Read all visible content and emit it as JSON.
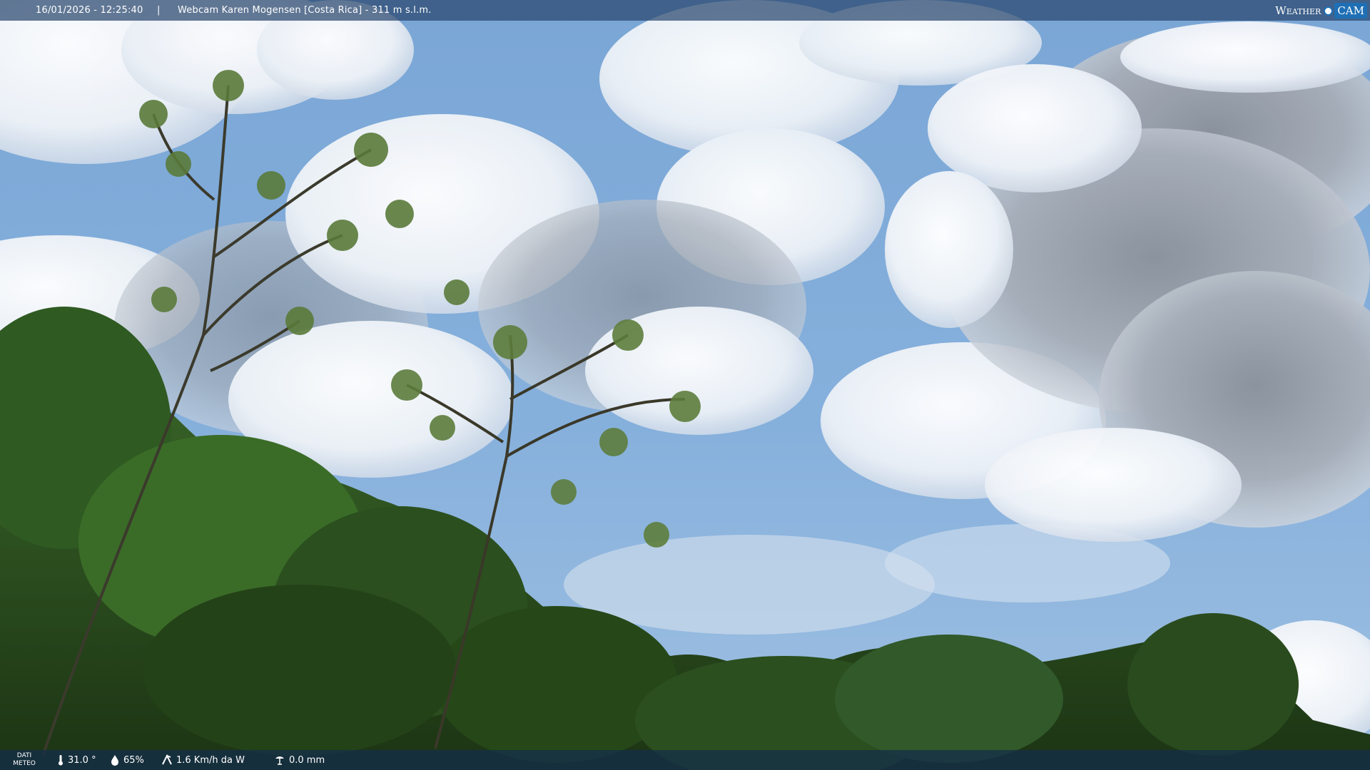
{
  "header": {
    "datetime": "16/01/2026 - 12:25:40",
    "separator": "|",
    "caption": "Webcam Karen Mogensen [Costa Rica] - 311 m s.l.m."
  },
  "logo": {
    "left_text": "Weather",
    "right_text": "CAM"
  },
  "footer": {
    "label_line1": "DATI",
    "label_line2": "METEO",
    "temperature": "31.0 °",
    "humidity": "65%",
    "wind": "1.6 Km/h da W",
    "rain": "0.0 mm",
    "icons": [
      "thermometer-icon",
      "humidity-drop-icon",
      "wind-icon",
      "rain-gauge-icon"
    ]
  },
  "colors": {
    "sky": "#6f9ccc",
    "bar": "#284670",
    "logo_blue": "#1f6fb5",
    "foliage": "#2f5a22"
  }
}
